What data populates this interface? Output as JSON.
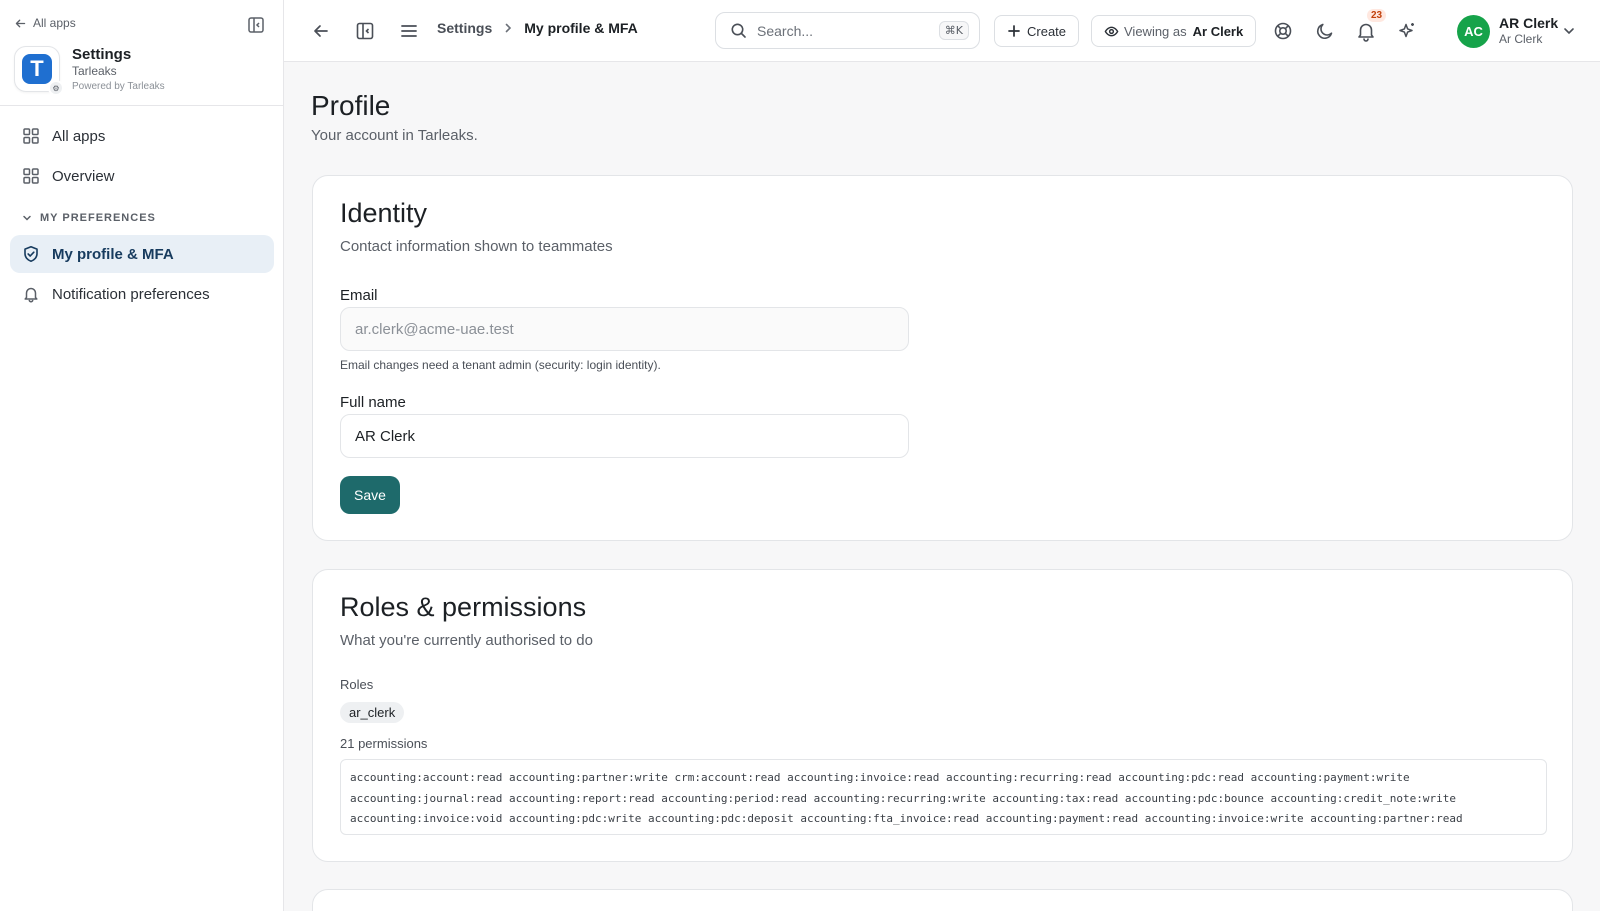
{
  "sidebar": {
    "back_label": "All apps",
    "app": {
      "logo_letter": "T",
      "name": "Settings",
      "tenant": "Tarleaks",
      "powered_by": "Powered by Tarleaks"
    },
    "items": [
      {
        "label": "All apps",
        "icon": "grid-icon"
      },
      {
        "label": "Overview",
        "icon": "grid-icon"
      }
    ],
    "section": {
      "label": "MY PREFERENCES",
      "items": [
        {
          "label": "My profile & MFA",
          "icon": "shield-icon",
          "active": true
        },
        {
          "label": "Notification preferences",
          "icon": "bell-icon",
          "active": false
        }
      ]
    }
  },
  "topbar": {
    "breadcrumb_root": "Settings",
    "breadcrumb_current": "My profile & MFA",
    "search_placeholder": "Search...",
    "search_shortcut": "⌘K",
    "create_label": "Create",
    "viewing_label": "Viewing as",
    "viewing_user": "Ar Clerk",
    "notification_count": "23",
    "user": {
      "initials": "AC",
      "name": "AR Clerk",
      "role": "Ar Clerk"
    }
  },
  "page": {
    "title": "Profile",
    "subtitle": "Your account in Tarleaks."
  },
  "identity": {
    "title": "Identity",
    "subtitle": "Contact information shown to teammates",
    "email_label": "Email",
    "email_value": "ar.clerk@acme-uae.test",
    "email_help": "Email changes need a tenant admin (security: login identity).",
    "fullname_label": "Full name",
    "fullname_value": "AR Clerk",
    "save_label": "Save"
  },
  "roles": {
    "title": "Roles & permissions",
    "subtitle": "What you're currently authorised to do",
    "roles_label": "Roles",
    "role_chip": "ar_clerk",
    "permissions_count": "21 permissions",
    "permission_lines": [
      "accounting:account:read accounting:partner:write crm:account:read accounting:invoice:read accounting:recurring:read accounting:pdc:read accounting:payment:write",
      "accounting:journal:read accounting:report:read accounting:period:read accounting:recurring:write accounting:tax:read accounting:pdc:bounce accounting:credit_note:write",
      "accounting:invoice:void accounting:pdc:write accounting:pdc:deposit accounting:fta_invoice:read accounting:payment:read accounting:invoice:write accounting:partner:read"
    ]
  },
  "colors": {
    "accent": "#1e6a6b",
    "active_nav_bg": "#e8eff6",
    "avatar": "#16a34a",
    "app_logo": "#1f6fd0"
  }
}
